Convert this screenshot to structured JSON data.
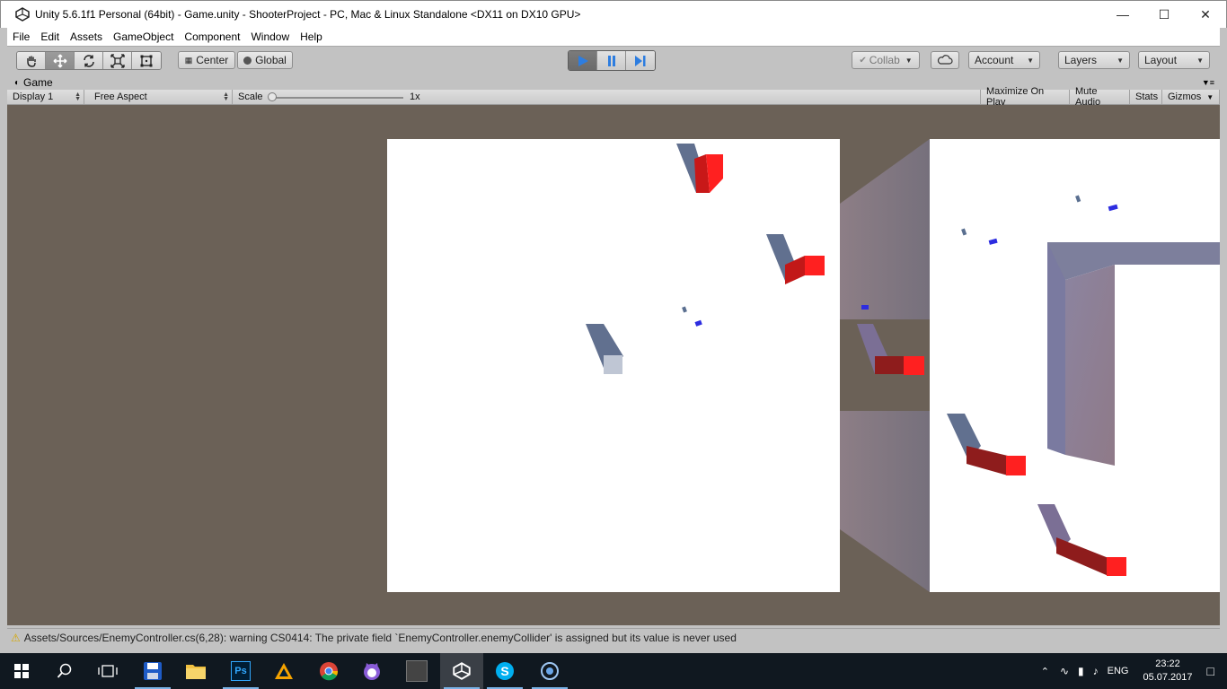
{
  "window": {
    "title": "Unity 5.6.1f1 Personal (64bit) - Game.unity - ShooterProject - PC, Mac & Linux Standalone <DX11 on DX10 GPU>",
    "minimize_icon": "minimize-icon",
    "maximize_icon": "maximize-icon",
    "close_icon": "close-icon"
  },
  "menu": [
    "File",
    "Edit",
    "Assets",
    "GameObject",
    "Component",
    "Window",
    "Help"
  ],
  "toolbar": {
    "tools": [
      "hand-tool-icon",
      "move-tool-icon",
      "rotate-tool-icon",
      "scale-tool-icon",
      "rect-tool-icon"
    ],
    "active_tool": "move-tool-icon",
    "pivot_label": "Center",
    "space_label": "Global",
    "collab_label": "Collab",
    "account_label": "Account",
    "layers_label": "Layers",
    "layout_label": "Layout",
    "playing": true
  },
  "game_tab": {
    "label": "Game"
  },
  "game_bar": {
    "display": "Display 1",
    "aspect": "Free Aspect",
    "scale_label": "Scale",
    "scale_value": "1x",
    "maximize_on_play": "Maximize On Play",
    "mute_audio": "Mute Audio",
    "stats": "Stats",
    "gizmos": "Gizmos"
  },
  "console": {
    "message": "Assets/Sources/EnemyController.cs(6,28): warning CS0414: The private field `EnemyController.enemyCollider' is assigned but its value is never used"
  },
  "taskbar": {
    "apps": [
      "save-app-icon",
      "file-explorer-icon",
      "photoshop-icon",
      "avast-icon",
      "chrome-icon",
      "cat-app-icon",
      "game-app-icon",
      "unity-app-icon",
      "skype-icon",
      "network-app-icon"
    ],
    "photoshop_text": "Ps",
    "language": "ENG",
    "time": "23:22",
    "date": "05.07.2017"
  },
  "colors": {
    "accent_play": "#2d7de0",
    "viewport_bg": "#6b6157",
    "enemy_red": "#ff1e1e"
  }
}
